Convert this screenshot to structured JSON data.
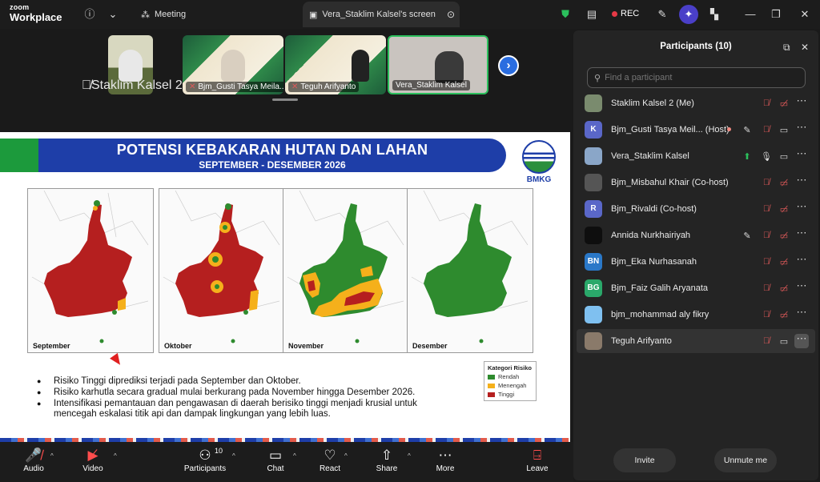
{
  "app": {
    "logo_line1": "zoom",
    "logo_line2": "Workplace"
  },
  "tabs": {
    "meeting": "Meeting",
    "screen_share": "Vera_Staklim Kalsel's screen"
  },
  "recording": {
    "label": "REC"
  },
  "thumbnails": [
    {
      "name": "Staklim Kalsel 2",
      "muted": true
    },
    {
      "name": "Bjm_Gusti Tasya Meila...",
      "muted": true
    },
    {
      "name": "Teguh Arifyanto",
      "muted": true
    },
    {
      "name": "Vera_Staklim Kalsel",
      "muted": false
    }
  ],
  "slide": {
    "title": "POTENSI KEBAKARAN HUTAN DAN LAHAN",
    "subtitle": "SEPTEMBER - DESEMBER 2026",
    "logo_text": "BMKG",
    "maps": [
      "September",
      "Oktober",
      "November",
      "Desember"
    ],
    "legend": {
      "title": "Kategori Risiko",
      "items": [
        {
          "label": "Rendah",
          "color": "#2e8b2e"
        },
        {
          "label": "Menengah",
          "color": "#f5b01b"
        },
        {
          "label": "Tinggi",
          "color": "#b51f1f"
        }
      ]
    },
    "bullets": [
      "Risiko Tinggi diprediksi terjadi pada September dan Oktober.",
      "Risiko karhutla secara gradual mulai berkurang pada November hingga Desember 2026.",
      "Intensifikasi pemantauan dan pengawasan di daerah berisiko tinggi menjadi krusial untuk mencegah eskalasi titik api dan dampak lingkungan yang lebih luas."
    ]
  },
  "toolbar": {
    "audio": "Audio",
    "video": "Video",
    "participants": "Participants",
    "participants_count": "10",
    "chat": "Chat",
    "react": "React",
    "share": "Share",
    "more": "More",
    "leave": "Leave"
  },
  "panel": {
    "title": "Participants (10)",
    "search_placeholder": "Find a participant",
    "invite": "Invite",
    "unmute_me": "Unmute me",
    "participants": [
      {
        "name": "Staklim Kalsel 2 (Me)",
        "avatar": "",
        "avatar_color": "#7a8b6e"
      },
      {
        "name": "Bjm_Gusti Tasya Meil... (Host)",
        "avatar": "K",
        "avatar_color": "#5a67c8"
      },
      {
        "name": "Vera_Staklim Kalsel",
        "avatar": "",
        "avatar_color": "#8aa6c8"
      },
      {
        "name": "Bjm_Misbahul Khair (Co-host)",
        "avatar": "",
        "avatar_color": "#555555"
      },
      {
        "name": "Bjm_Rivaldi (Co-host)",
        "avatar": "R",
        "avatar_color": "#5a67c8"
      },
      {
        "name": "Annida Nurkhairiyah",
        "avatar": "",
        "avatar_color": "#0e0e0e"
      },
      {
        "name": "Bjm_Eka Nurhasanah",
        "avatar": "BN",
        "avatar_color": "#2a78c8"
      },
      {
        "name": "Bjm_Faiz Galih Aryanata",
        "avatar": "BG",
        "avatar_color": "#2aa86a"
      },
      {
        "name": "bjm_mohammad aly fikry",
        "avatar": "",
        "avatar_color": "#7fc0f0"
      },
      {
        "name": "Teguh Arifyanto",
        "avatar": "",
        "avatar_color": "#8a7a6a"
      }
    ]
  }
}
